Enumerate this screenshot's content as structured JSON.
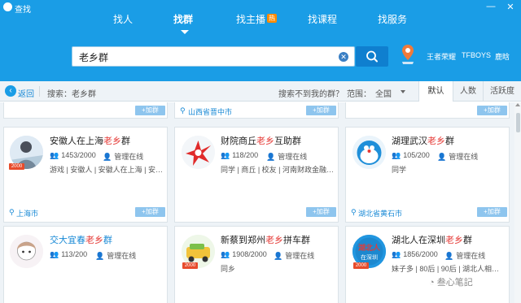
{
  "window": {
    "title": "查找",
    "controls": {
      "min": "—",
      "close": "✕"
    }
  },
  "nav": {
    "tabs": [
      {
        "label": "找人",
        "active": false
      },
      {
        "label": "找群",
        "active": true
      },
      {
        "label": "找主播",
        "active": false,
        "badge": "热"
      },
      {
        "label": "找课程",
        "active": false
      },
      {
        "label": "找服务",
        "active": false
      }
    ]
  },
  "search": {
    "value": "老乡群",
    "placeholder": "",
    "hot_words": [
      "王者荣耀",
      "TFBOYS",
      "鹿晗"
    ]
  },
  "filter": {
    "back": "返回",
    "query": "搜索：老乡群",
    "not_found": "搜索不到我的群？",
    "range_label": "范围：",
    "range_value": "全国",
    "sorts": [
      "默认",
      "人数",
      "活跃度"
    ]
  },
  "join_label": "+加群",
  "top_strip": {
    "middle_location": "山西省晋中市"
  },
  "cards": [
    {
      "name_pre": "安徽人在上海",
      "name_kw": "老乡",
      "name_post": "群",
      "name_highlight": false,
      "members": "1453/2000",
      "admin": "管理在线",
      "tags": "游戏 | 安徽人 | 安徽人在上海 | 安…",
      "location": "上海市",
      "badge": "2000"
    },
    {
      "name_pre": "财院商丘",
      "name_kw": "老乡",
      "name_post": "互助群",
      "name_highlight": false,
      "members": "118/200",
      "admin": "管理在线",
      "tags": "同学 | 商丘 | 校友 | 河南财政金融…",
      "location": "",
      "badge": ""
    },
    {
      "name_pre": "湖理武汉",
      "name_kw": "老乡",
      "name_post": "群",
      "name_highlight": false,
      "members": "105/200",
      "admin": "管理在线",
      "tags": "同学",
      "location": "湖北省黄石市",
      "badge": ""
    },
    {
      "name_pre": "交大宜春",
      "name_kw": "老乡",
      "name_post": "群",
      "name_highlight": true,
      "members": "113/200",
      "admin": "管理在线",
      "tags": "",
      "location": "",
      "badge": ""
    },
    {
      "name_pre": "新蔡到郑州",
      "name_kw": "老乡",
      "name_post": "拼车群",
      "name_highlight": false,
      "members": "1908/2000",
      "admin": "管理在线",
      "tags": "同乡",
      "location": "",
      "badge": "2000"
    },
    {
      "name_pre": "湖北人在深圳",
      "name_kw": "老乡",
      "name_post": "群",
      "name_highlight": false,
      "members": "1856/2000",
      "admin": "管理在线",
      "tags": "妹子多 | 80后 | 90后 | 湖北人相…",
      "location": "",
      "badge": "2000"
    }
  ],
  "avatar_texts": {
    "hubei": "湖北人在深圳"
  },
  "watermark": "叁心笔記",
  "colors": {
    "brand": "#1a9de6",
    "keyword": "#e53935",
    "link": "#1a8ad6",
    "join": "#8ec5ee"
  }
}
